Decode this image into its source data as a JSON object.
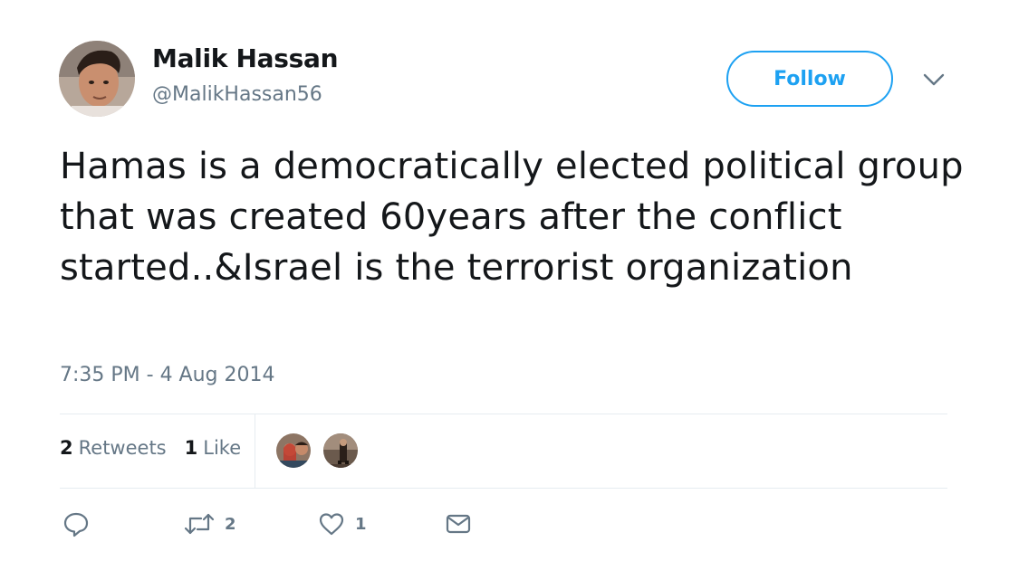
{
  "user": {
    "name": "Malik Hassan",
    "handle": "@MalikHassan56"
  },
  "header": {
    "follow_label": "Follow",
    "menu_icon": "chevron-down-icon"
  },
  "tweet": {
    "text": "Hamas is a democratically elected political group that was created 60years after the conflict started..&Israel is the terrorist organization",
    "timestamp": "7:35 PM - 4 Aug 2014"
  },
  "stats": {
    "retweets_count": "2",
    "retweets_label": "Retweets",
    "likes_count": "1",
    "likes_label": "Like"
  },
  "actions": {
    "reply_icon": "reply-icon",
    "retweet_icon": "retweet-icon",
    "retweet_count": "2",
    "like_icon": "heart-icon",
    "like_count": "1",
    "message_icon": "envelope-icon"
  },
  "colors": {
    "accent": "#1da1f2",
    "text": "#14171a",
    "muted": "#657786",
    "divider": "#e6ecf0"
  }
}
